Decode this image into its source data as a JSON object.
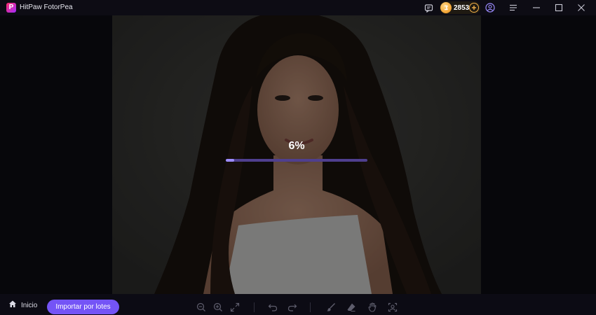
{
  "app": {
    "logo_letter": "P",
    "title": "HitPaw FotorPea"
  },
  "titlebar": {
    "credits": "2853",
    "icons": [
      "feedback-icon",
      "coin-icon",
      "add-credits-icon",
      "account-icon",
      "menu-icon",
      "minimize-icon",
      "maximize-icon",
      "close-icon"
    ]
  },
  "processing": {
    "percent_label": "6%",
    "progress": 0.06
  },
  "bottombar": {
    "home_label": "Inicio",
    "batch_import_label": "Importar por lotes",
    "tools": [
      "zoom-out-icon",
      "zoom-in-icon",
      "fit-screen-icon",
      "undo-icon",
      "redo-icon",
      "brush-icon",
      "eraser-icon",
      "hand-icon",
      "compare-icon"
    ]
  },
  "colors": {
    "accent": "#7454f6",
    "progress_fill": "#9d8cff",
    "progress_track": "#4f3f8f",
    "coin": "#f4a93b"
  }
}
